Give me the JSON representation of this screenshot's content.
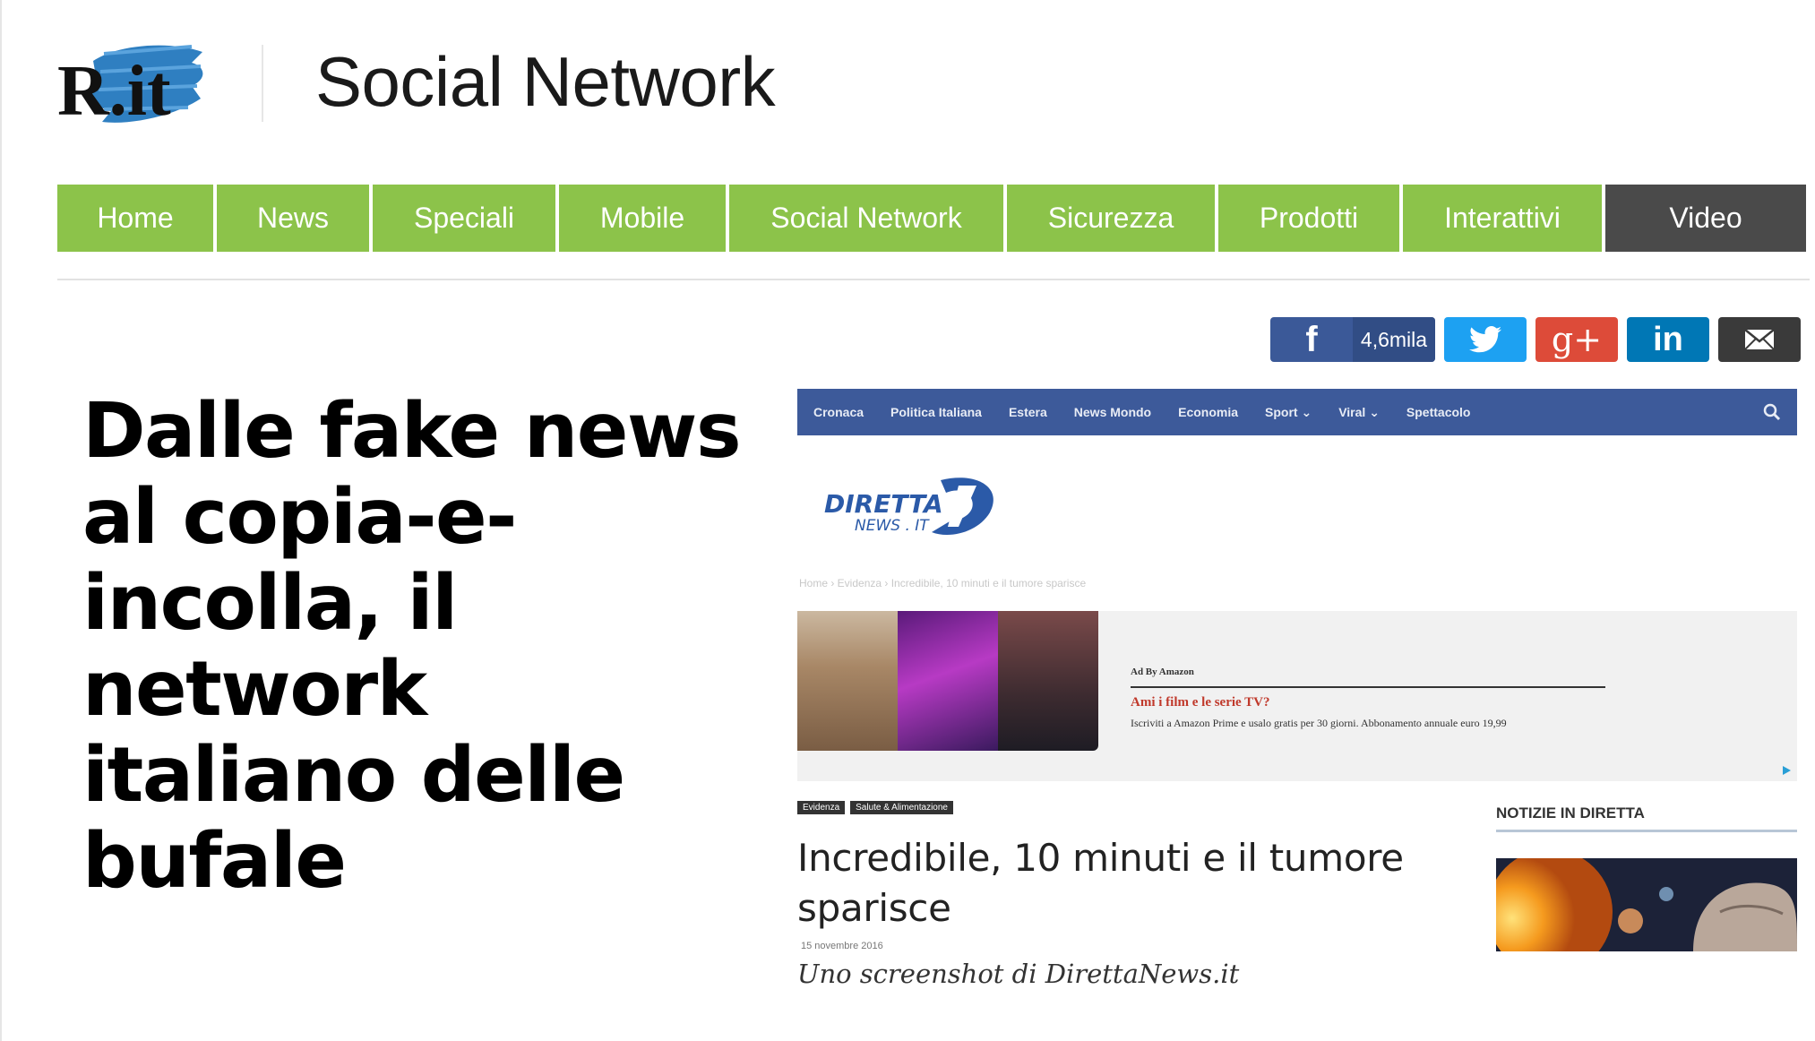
{
  "header": {
    "logo_text": "R.it",
    "section_title": "Social Network"
  },
  "nav": {
    "items": [
      {
        "label": "Home"
      },
      {
        "label": "News"
      },
      {
        "label": "Speciali"
      },
      {
        "label": "Mobile"
      },
      {
        "label": "Social Network"
      },
      {
        "label": "Sicurezza"
      },
      {
        "label": "Prodotti"
      },
      {
        "label": "Interattivi"
      },
      {
        "label": "Video"
      }
    ]
  },
  "share": {
    "facebook_count": "4,6mila",
    "facebook_icon": "f",
    "googleplus_icon": "g+",
    "linkedin_icon": "in"
  },
  "article": {
    "headline": "Dalle fake news al copia-e-incolla, il network italiano delle bufale",
    "caption": "Uno screenshot di DirettaNews.it"
  },
  "screenshot": {
    "nav": [
      "Cronaca",
      "Politica Italiana",
      "Estera",
      "News Mondo",
      "Economia",
      "Sport ⌄",
      "Viral ⌄",
      "Spettacolo"
    ],
    "logo_main": "DIRETTA",
    "logo_sub": "NEWS . IT",
    "breadcrumb": "Home  ›  Evidenza  ›  Incredibile, 10 minuti e il tumore sparisce",
    "ad_by": "Ad By Amazon",
    "ad_title": "Ami i film e le serie TV?",
    "ad_desc": "Iscriviti a Amazon Prime e usalo gratis per 30 giorni. Abbonamento annuale euro 19,99",
    "tags": [
      "Evidenza",
      "Salute & Alimentazione"
    ],
    "article_title": "Incredibile, 10 minuti e il tumore sparisce",
    "article_date": "15 novembre 2016",
    "sidebar_heading": "NOTIZIE IN DIRETTA"
  },
  "colors": {
    "nav_green": "#8cc34a",
    "nav_dark": "#4a4a4a",
    "facebook": "#3b5998",
    "twitter": "#1da1f2",
    "googleplus": "#dd4b39",
    "linkedin": "#0077b5",
    "email": "#3a3a3a",
    "shot_nav": "#3d5a9a"
  }
}
